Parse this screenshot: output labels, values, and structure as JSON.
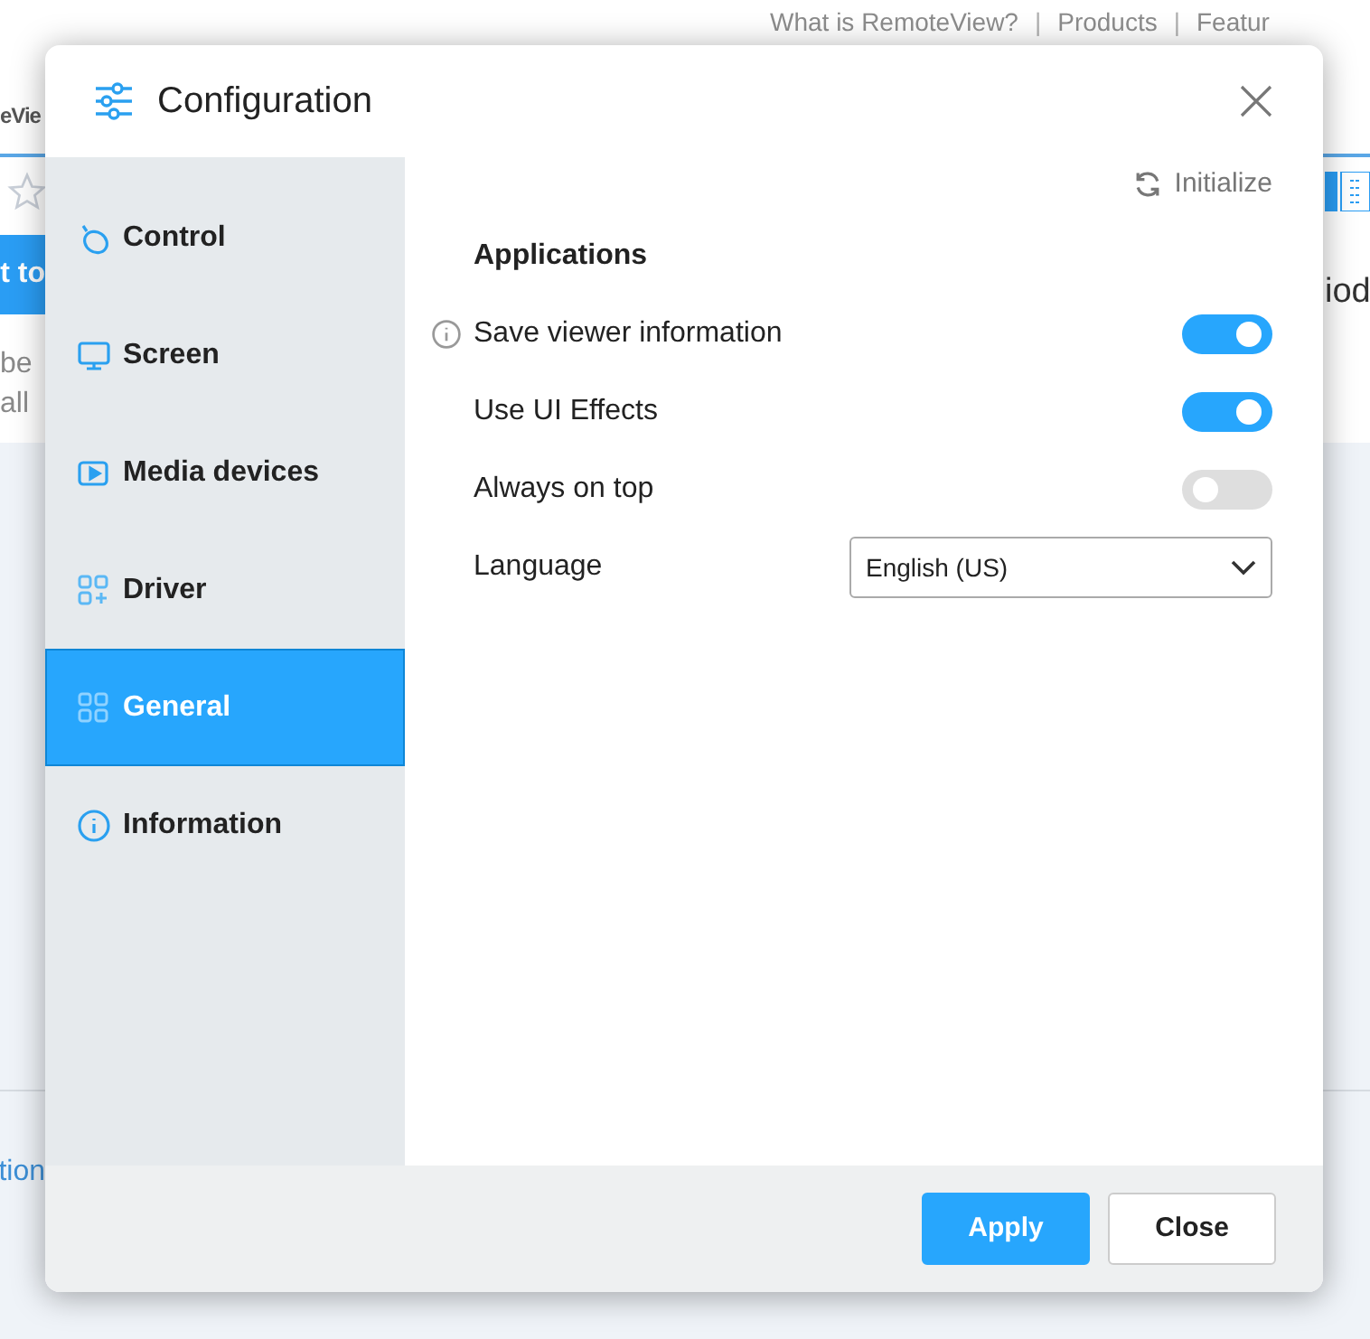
{
  "background": {
    "nav_links": [
      {
        "kind": "link",
        "text": "What is RemoteView?"
      },
      {
        "kind": "sep",
        "text": "|"
      },
      {
        "kind": "link",
        "text": "Products"
      },
      {
        "kind": "sep",
        "text": "|"
      },
      {
        "kind": "link",
        "text": "Featur"
      }
    ],
    "fragments": [
      {
        "kind": "title",
        "text": "eVie"
      },
      {
        "kind": "banner",
        "text": "t to"
      },
      {
        "kind": "note",
        "text": "be"
      },
      {
        "kind": "note",
        "text": "all"
      },
      {
        "kind": "link",
        "text": "tion"
      },
      {
        "kind": "side",
        "text": "iod"
      }
    ]
  },
  "dialog": {
    "title": "Configuration",
    "sidebar": [
      {
        "label": "Control",
        "selected": false
      },
      {
        "label": "Screen",
        "selected": false
      },
      {
        "label": "Media devices",
        "selected": false
      },
      {
        "label": "Driver",
        "selected": false
      },
      {
        "label": "General",
        "selected": true
      },
      {
        "label": "Information",
        "selected": false
      }
    ],
    "initialize": "Initialize",
    "section": "Applications",
    "settings": [
      {
        "kind": "toggle",
        "label": "Save viewer information",
        "info": true,
        "on": true
      },
      {
        "kind": "toggle",
        "label": "Use UI Effects",
        "info": false,
        "on": true
      },
      {
        "kind": "toggle",
        "label": "Always on top",
        "info": false,
        "on": false
      },
      {
        "kind": "select",
        "label": "Language",
        "info": false,
        "value": "English (US)"
      }
    ],
    "buttons": [
      {
        "label": "Apply",
        "primary": true
      },
      {
        "label": "Close",
        "primary": false
      }
    ]
  }
}
